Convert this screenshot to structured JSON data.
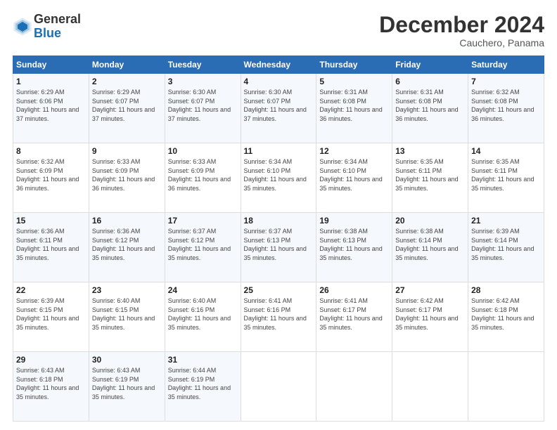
{
  "logo": {
    "general": "General",
    "blue": "Blue"
  },
  "header": {
    "month": "December 2024",
    "location": "Cauchero, Panama"
  },
  "weekdays": [
    "Sunday",
    "Monday",
    "Tuesday",
    "Wednesday",
    "Thursday",
    "Friday",
    "Saturday"
  ],
  "weeks": [
    [
      {
        "day": "1",
        "sunrise": "6:29 AM",
        "sunset": "6:06 PM",
        "daylight": "11 hours and 37 minutes."
      },
      {
        "day": "2",
        "sunrise": "6:29 AM",
        "sunset": "6:07 PM",
        "daylight": "11 hours and 37 minutes."
      },
      {
        "day": "3",
        "sunrise": "6:30 AM",
        "sunset": "6:07 PM",
        "daylight": "11 hours and 37 minutes."
      },
      {
        "day": "4",
        "sunrise": "6:30 AM",
        "sunset": "6:07 PM",
        "daylight": "11 hours and 37 minutes."
      },
      {
        "day": "5",
        "sunrise": "6:31 AM",
        "sunset": "6:08 PM",
        "daylight": "11 hours and 36 minutes."
      },
      {
        "day": "6",
        "sunrise": "6:31 AM",
        "sunset": "6:08 PM",
        "daylight": "11 hours and 36 minutes."
      },
      {
        "day": "7",
        "sunrise": "6:32 AM",
        "sunset": "6:08 PM",
        "daylight": "11 hours and 36 minutes."
      }
    ],
    [
      {
        "day": "8",
        "sunrise": "6:32 AM",
        "sunset": "6:09 PM",
        "daylight": "11 hours and 36 minutes."
      },
      {
        "day": "9",
        "sunrise": "6:33 AM",
        "sunset": "6:09 PM",
        "daylight": "11 hours and 36 minutes."
      },
      {
        "day": "10",
        "sunrise": "6:33 AM",
        "sunset": "6:09 PM",
        "daylight": "11 hours and 36 minutes."
      },
      {
        "day": "11",
        "sunrise": "6:34 AM",
        "sunset": "6:10 PM",
        "daylight": "11 hours and 35 minutes."
      },
      {
        "day": "12",
        "sunrise": "6:34 AM",
        "sunset": "6:10 PM",
        "daylight": "11 hours and 35 minutes."
      },
      {
        "day": "13",
        "sunrise": "6:35 AM",
        "sunset": "6:11 PM",
        "daylight": "11 hours and 35 minutes."
      },
      {
        "day": "14",
        "sunrise": "6:35 AM",
        "sunset": "6:11 PM",
        "daylight": "11 hours and 35 minutes."
      }
    ],
    [
      {
        "day": "15",
        "sunrise": "6:36 AM",
        "sunset": "6:11 PM",
        "daylight": "11 hours and 35 minutes."
      },
      {
        "day": "16",
        "sunrise": "6:36 AM",
        "sunset": "6:12 PM",
        "daylight": "11 hours and 35 minutes."
      },
      {
        "day": "17",
        "sunrise": "6:37 AM",
        "sunset": "6:12 PM",
        "daylight": "11 hours and 35 minutes."
      },
      {
        "day": "18",
        "sunrise": "6:37 AM",
        "sunset": "6:13 PM",
        "daylight": "11 hours and 35 minutes."
      },
      {
        "day": "19",
        "sunrise": "6:38 AM",
        "sunset": "6:13 PM",
        "daylight": "11 hours and 35 minutes."
      },
      {
        "day": "20",
        "sunrise": "6:38 AM",
        "sunset": "6:14 PM",
        "daylight": "11 hours and 35 minutes."
      },
      {
        "day": "21",
        "sunrise": "6:39 AM",
        "sunset": "6:14 PM",
        "daylight": "11 hours and 35 minutes."
      }
    ],
    [
      {
        "day": "22",
        "sunrise": "6:39 AM",
        "sunset": "6:15 PM",
        "daylight": "11 hours and 35 minutes."
      },
      {
        "day": "23",
        "sunrise": "6:40 AM",
        "sunset": "6:15 PM",
        "daylight": "11 hours and 35 minutes."
      },
      {
        "day": "24",
        "sunrise": "6:40 AM",
        "sunset": "6:16 PM",
        "daylight": "11 hours and 35 minutes."
      },
      {
        "day": "25",
        "sunrise": "6:41 AM",
        "sunset": "6:16 PM",
        "daylight": "11 hours and 35 minutes."
      },
      {
        "day": "26",
        "sunrise": "6:41 AM",
        "sunset": "6:17 PM",
        "daylight": "11 hours and 35 minutes."
      },
      {
        "day": "27",
        "sunrise": "6:42 AM",
        "sunset": "6:17 PM",
        "daylight": "11 hours and 35 minutes."
      },
      {
        "day": "28",
        "sunrise": "6:42 AM",
        "sunset": "6:18 PM",
        "daylight": "11 hours and 35 minutes."
      }
    ],
    [
      {
        "day": "29",
        "sunrise": "6:43 AM",
        "sunset": "6:18 PM",
        "daylight": "11 hours and 35 minutes."
      },
      {
        "day": "30",
        "sunrise": "6:43 AM",
        "sunset": "6:19 PM",
        "daylight": "11 hours and 35 minutes."
      },
      {
        "day": "31",
        "sunrise": "6:44 AM",
        "sunset": "6:19 PM",
        "daylight": "11 hours and 35 minutes."
      },
      null,
      null,
      null,
      null
    ]
  ]
}
